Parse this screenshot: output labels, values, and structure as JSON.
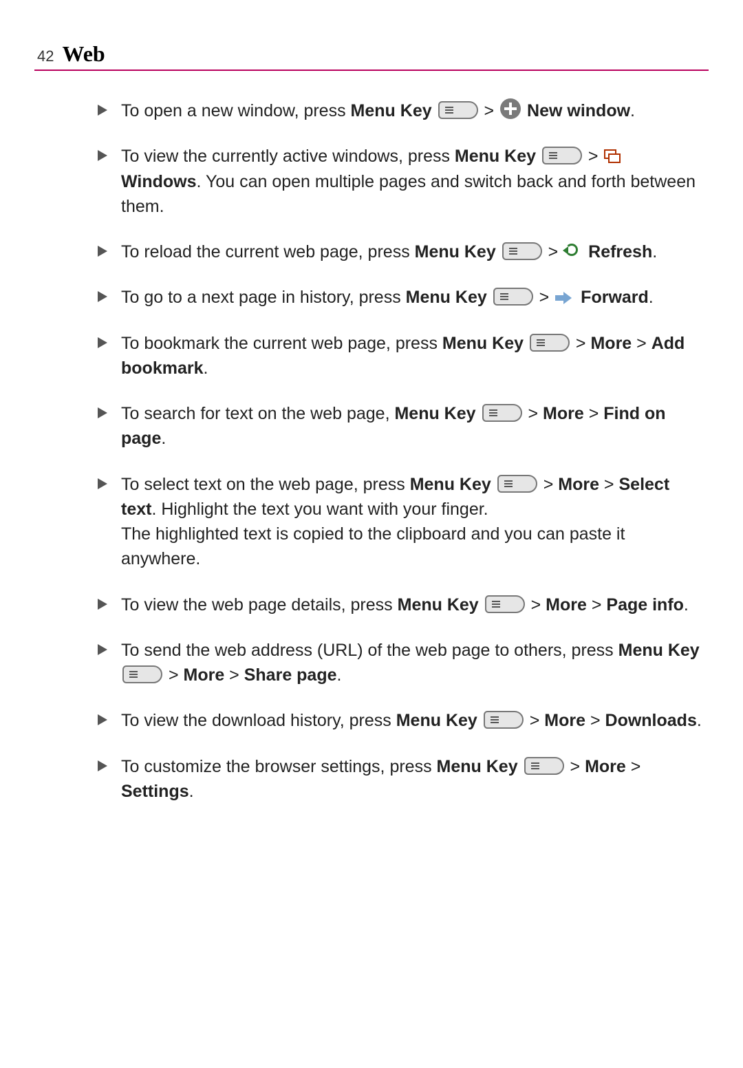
{
  "page_number": "42",
  "section_title": "Web",
  "labels": {
    "menu_key": "Menu Key",
    "more": "More",
    "new_window": "New window",
    "windows": "Windows",
    "refresh": "Refresh",
    "forward": "Forward",
    "add_bookmark": "Add bookmark",
    "find_on_page": "Find on page",
    "select_text": "Select text",
    "page_info": "Page info",
    "share_page": "Share page",
    "downloads": "Downloads",
    "settings": "Settings"
  },
  "text": {
    "b1a": "To open a new window, press ",
    "b1b": ".",
    "b2a": "To view the currently active windows, press ",
    "b2b": ". You can open multiple pages and switch back and forth between them.",
    "b3a": "To reload the current web page, press ",
    "b3b": ".",
    "b4a": "To go to a next page in history, press ",
    "b4b": ".",
    "b5a": "To bookmark the current web page, press ",
    "b5b": ".",
    "b6a": "To search for text on the web page, ",
    "b6b": ".",
    "b7a": "To select text on the web page, press ",
    "b7b": ". Highlight the text you want with your finger.",
    "b7c": "The highlighted text is copied to the clipboard and you can paste it anywhere.",
    "b8a": "To view the web page details, press ",
    "b8b": ".",
    "b9a": "To send the web address (URL) of the web page to others, press ",
    "b9b": ".",
    "b10a": "To view the download history, press ",
    "b10b": ".",
    "b11a": "To customize the browser settings, press ",
    "b11b": "."
  }
}
